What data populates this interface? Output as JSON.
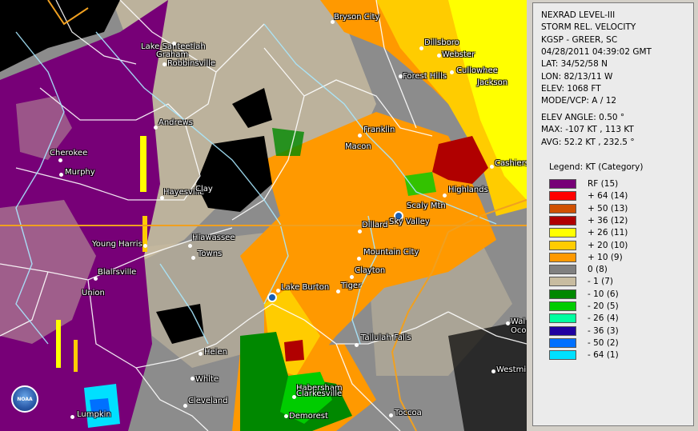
{
  "panel": {
    "lines": [
      "NEXRAD LEVEL-III",
      "STORM REL. VELOCITY",
      "KGSP - GREER, SC",
      "04/28/2011 04:39:02 GMT",
      "LAT: 34/52/58 N",
      "LON: 82/13/11 W",
      "ELEV: 1068 FT",
      "MODE/VCP: A / 12"
    ],
    "lines2": [
      "ELEV ANGLE: 0.50 °",
      "MAX: -107 KT , 113 KT",
      "AVG: 52.2 KT , 232.5 °"
    ],
    "legend_title": "Legend: KT (Category)",
    "legend": [
      {
        "label": "RF  (15)",
        "color": "#770077"
      },
      {
        "label": "+ 64  (14)",
        "color": "#ff0000"
      },
      {
        "label": "+ 50  (13)",
        "color": "#d05000"
      },
      {
        "label": "+ 36  (12)",
        "color": "#b00000"
      },
      {
        "label": "+ 26  (11)",
        "color": "#ffff00"
      },
      {
        "label": "+ 20  (10)",
        "color": "#ffcc00"
      },
      {
        "label": "+ 10  (9)",
        "color": "#ff9900"
      },
      {
        "label": "0  (8)",
        "color": "#808080"
      },
      {
        "label": "- 1  (7)",
        "color": "#c8bca0"
      },
      {
        "label": "- 10  (6)",
        "color": "#008800"
      },
      {
        "label": "- 20  (5)",
        "color": "#00cc00"
      },
      {
        "label": "- 26  (4)",
        "color": "#00ffa0"
      },
      {
        "label": "- 36  (3)",
        "color": "#2000a0"
      },
      {
        "label": "- 50  (2)",
        "color": "#0070ff"
      },
      {
        "label": "- 64  (1)",
        "color": "#00e0ff"
      }
    ]
  },
  "map": {
    "logo": "NOAA",
    "places": [
      "Bryson City",
      "Dillsboro",
      "Webster",
      "Cullowhee",
      "Jackson",
      "Forest Hills",
      "Lake Santeetlah",
      "Graham",
      "Robbinsville",
      "Andrews",
      "Franklin",
      "Macon",
      "Cherokee",
      "Murphy",
      "Hayesville",
      "Clay",
      "Cashiers",
      "Highlands",
      "Scaly Mtn",
      "Sky Valley",
      "Dillard",
      "Hiawassee",
      "Towns",
      "Young Harris",
      "Mountain City",
      "Clayton",
      "Blairsville",
      "Union",
      "Lake Burton",
      "Tiger",
      "Tallulah Falls",
      "Helen",
      "White",
      "Habersham",
      "Clarkesville",
      "Cleveland",
      "Demorest",
      "Toccoa",
      "Lumpkin",
      "Westmi",
      "Wal",
      "Oco"
    ]
  }
}
